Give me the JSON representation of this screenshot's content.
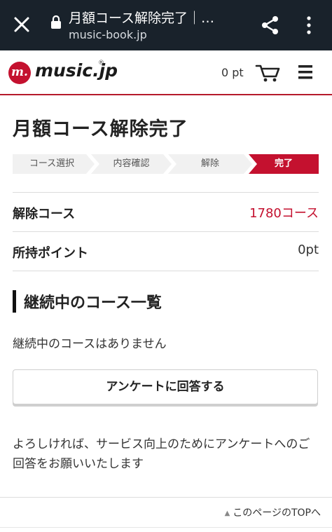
{
  "browser": {
    "title": "月額コース解除完了｜…",
    "url": "music-book.jp"
  },
  "site": {
    "logo_mark": "m.",
    "logo_text": "music.jp",
    "logo_reg": "®",
    "points": "0 pt"
  },
  "page": {
    "title": "月額コース解除完了",
    "steps": [
      "コース選択",
      "内容確認",
      "解除",
      "完了"
    ],
    "active_step": 3,
    "rows": [
      {
        "label": "解除コース",
        "value": "1780コース",
        "value_color": "#c4112f"
      },
      {
        "label": "所持ポイント",
        "value": "0pt",
        "value_color": "#333333"
      }
    ],
    "section_title": "継続中のコース一覧",
    "no_courses": "継続中のコースはありません",
    "survey_button": "アンケートに回答する",
    "survey_info": "よろしければ、サービス向上のためにアンケートへのご回答をお願いいたします",
    "to_top": "このページのTOPへ"
  },
  "colors": {
    "accent": "#c4112f",
    "browser_bar": "#19222b",
    "step_bg": "#f1f1f1"
  },
  "icons": [
    "close-icon",
    "lock-icon",
    "share-icon",
    "more-icon",
    "cart-icon",
    "menu-icon",
    "triangle-up-icon"
  ]
}
